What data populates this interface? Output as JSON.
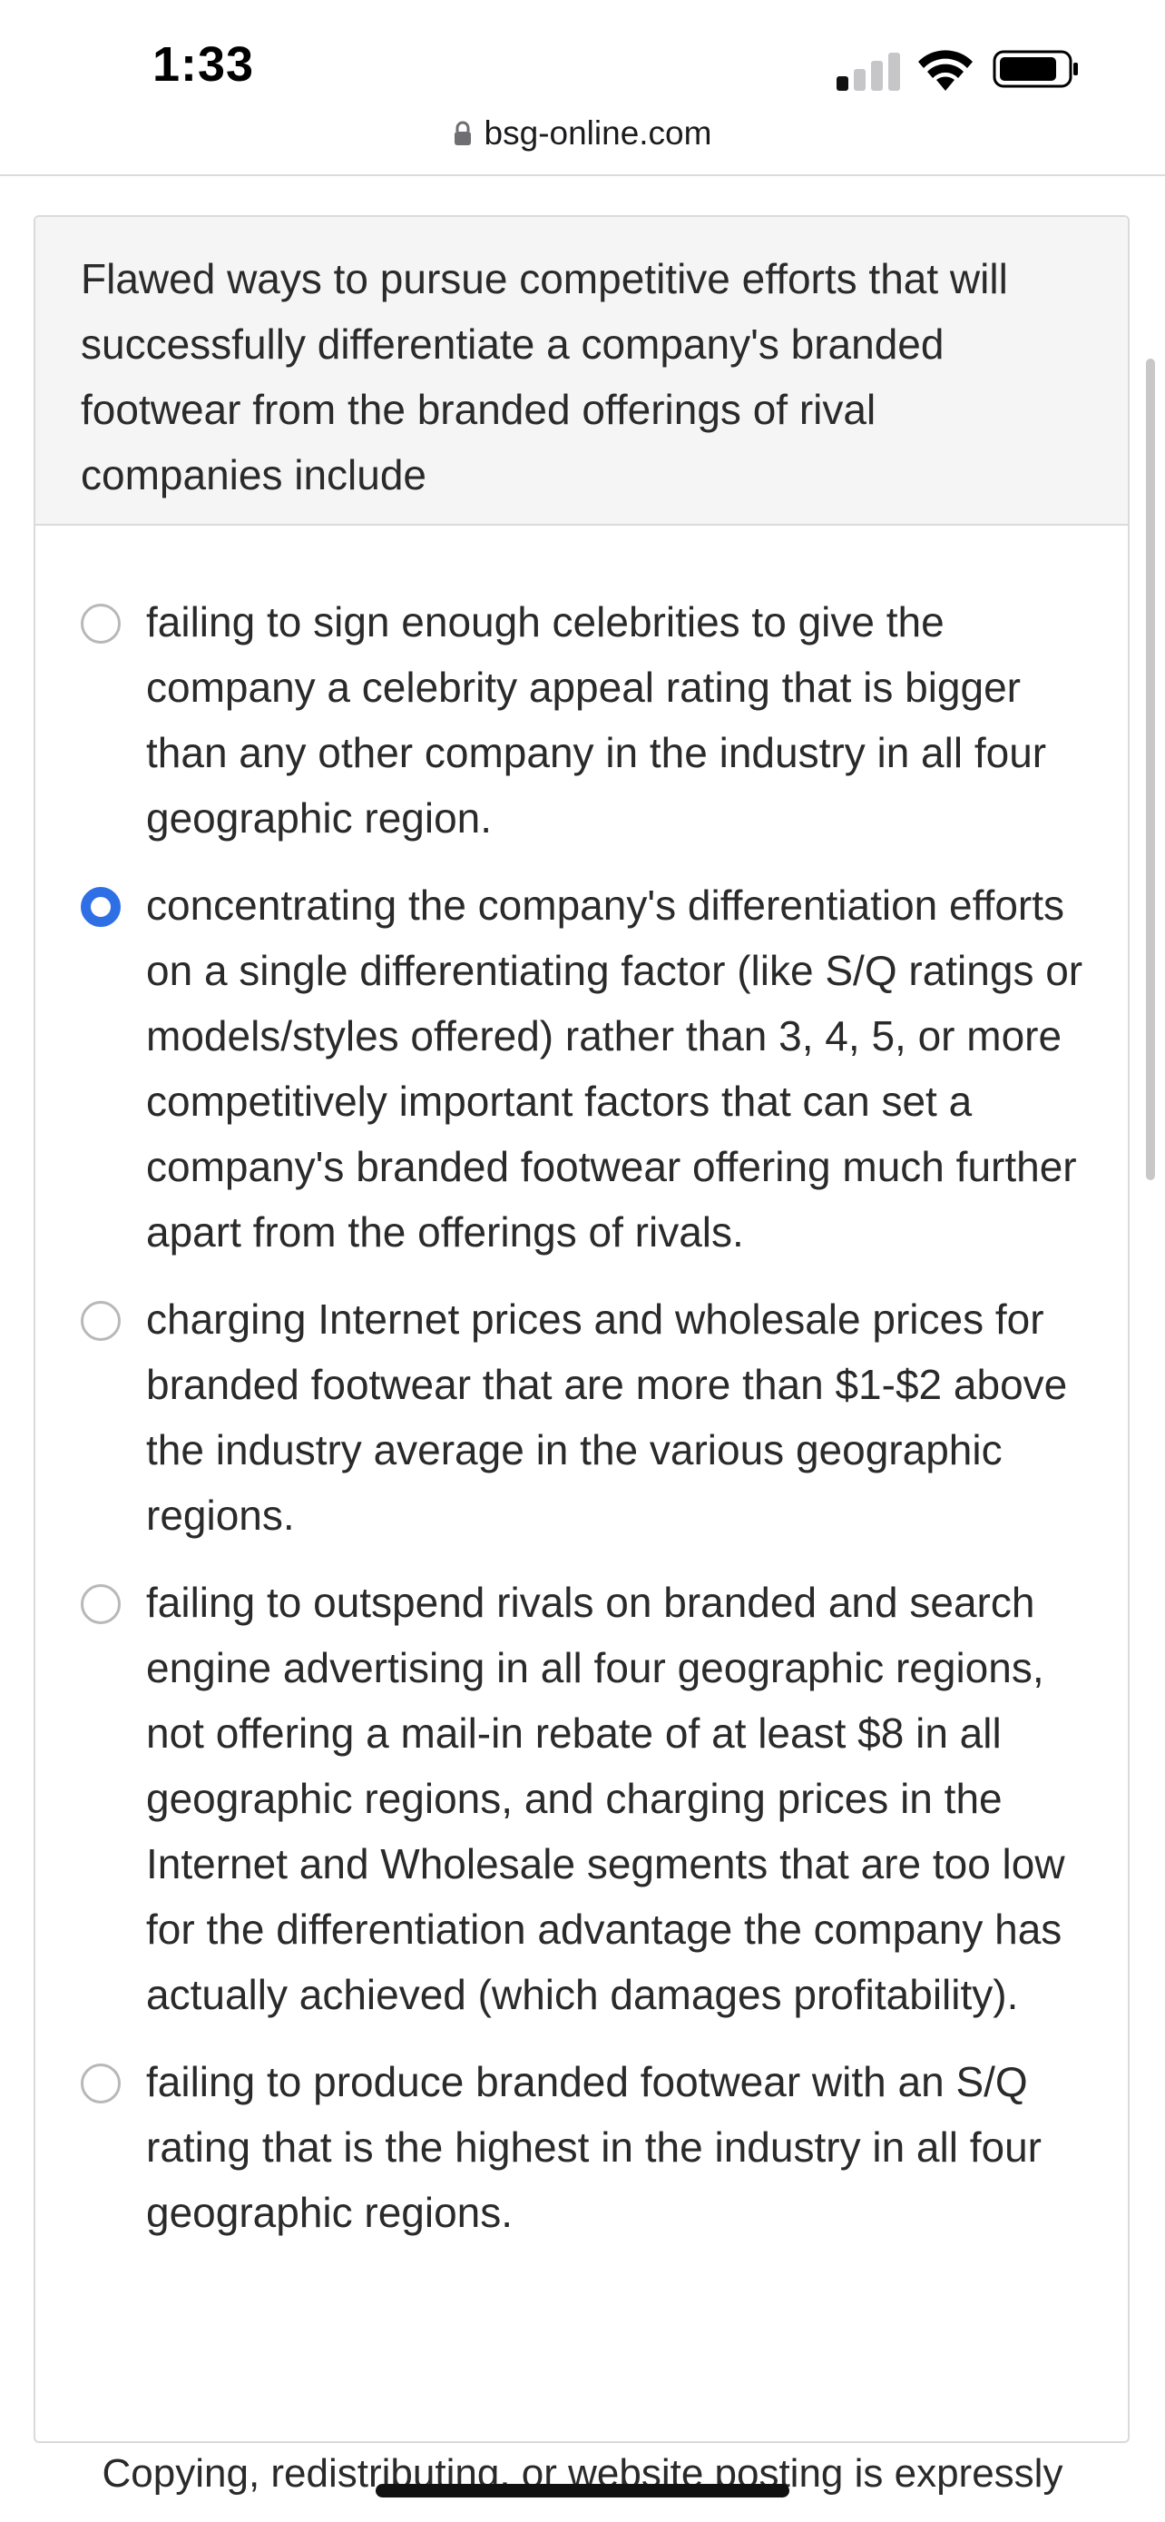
{
  "status_bar": {
    "time": "1:33"
  },
  "browser": {
    "url": "bsg-online.com"
  },
  "question": {
    "text": "Flawed ways to pursue competitive efforts that will successfully differentiate a company's branded footwear from the branded offerings of rival companies include"
  },
  "options": [
    {
      "label": "failing to sign enough celebrities to give the company a celebrity appeal rating that is bigger than any other company in the industry in all four geographic region.",
      "selected": false
    },
    {
      "label": "concentrating the company's differentiation efforts on a single differentiating factor (like S/Q ratings or models/styles offered) rather than 3, 4, 5, or more competitively important factors that can set a company's branded footwear offering much further apart from the offerings of rivals.",
      "selected": true
    },
    {
      "label": "charging Internet prices and wholesale prices for branded footwear that are more than $1-$2 above the industry average in the various geographic regions.",
      "selected": false
    },
    {
      "label": "failing to outspend rivals on branded and search engine advertising in all four geographic regions, not offering a mail-in rebate of at least $8 in all geographic regions, and charging prices in the Internet and Wholesale segments that are too low for the differentiation advantage the company has actually achieved (which damages profitability).",
      "selected": false
    },
    {
      "label": "failing to produce branded footwear with an S/Q rating that is the highest in the industry in all four geographic regions.",
      "selected": false
    }
  ],
  "footer": {
    "text": "Copying, redistributing, or website posting is expressly"
  },
  "colors": {
    "accent": "#2f6fe6",
    "question_bg": "#f5f5f5"
  }
}
